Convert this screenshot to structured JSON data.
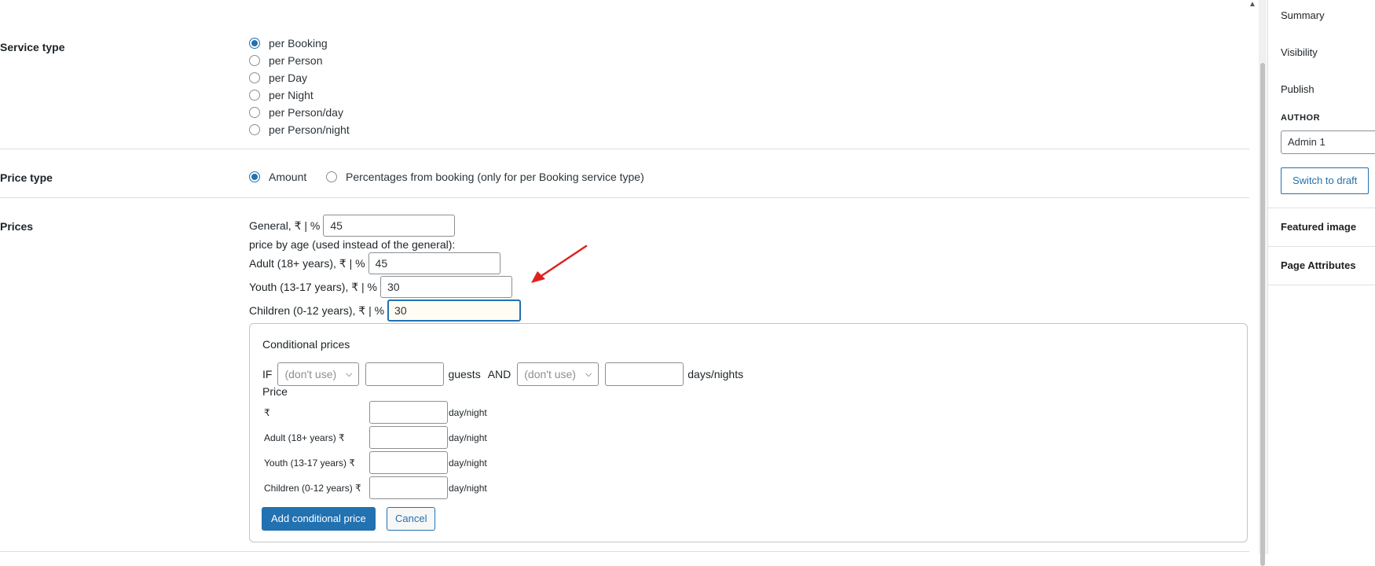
{
  "service_type": {
    "label": "Service type",
    "options": [
      {
        "label": "per Booking",
        "checked": true
      },
      {
        "label": "per Person",
        "checked": false
      },
      {
        "label": "per Day",
        "checked": false
      },
      {
        "label": "per Night",
        "checked": false
      },
      {
        "label": "per Person/day",
        "checked": false
      },
      {
        "label": "per Person/night",
        "checked": false
      }
    ]
  },
  "price_type": {
    "label": "Price type",
    "options": [
      {
        "label": "Amount",
        "checked": true
      },
      {
        "label": "Percentages from booking (only for per Booking service type)",
        "checked": false
      }
    ]
  },
  "prices": {
    "label": "Prices",
    "general_label": "General, ₹ | %",
    "general_value": "45",
    "by_age_note": "price by age (used instead of the general):",
    "adult_label": "Adult (18+ years), ₹ | %",
    "adult_value": "45",
    "youth_label": "Youth (13-17 years), ₹ | %",
    "youth_value": "30",
    "children_label": "Children (0-12 years), ₹ | %",
    "children_value": "30"
  },
  "conditional": {
    "title": "Conditional prices",
    "if_label": "IF",
    "select1": "(don't use)",
    "guests_label": "guests",
    "and_label": "AND",
    "select2": "(don't use)",
    "days_label": "days/nights",
    "price_label": "Price",
    "rows": [
      {
        "label": "₹",
        "unit": "day/night"
      },
      {
        "label": "Adult (18+ years) ₹",
        "unit": "day/night"
      },
      {
        "label": "Youth (13-17 years) ₹",
        "unit": "day/night"
      },
      {
        "label": "Children (0-12 years) ₹",
        "unit": "day/night"
      }
    ],
    "add_button": "Add conditional price",
    "cancel_button": "Cancel"
  },
  "annotation": {
    "color": "#e02020"
  },
  "sidebar": {
    "summary": "Summary",
    "visibility": "Visibility",
    "publish": "Publish",
    "author_label": "AUTHOR",
    "author_value": "Admin 1",
    "switch_draft": "Switch to draft",
    "featured_image": "Featured image",
    "page_attributes": "Page Attributes"
  }
}
